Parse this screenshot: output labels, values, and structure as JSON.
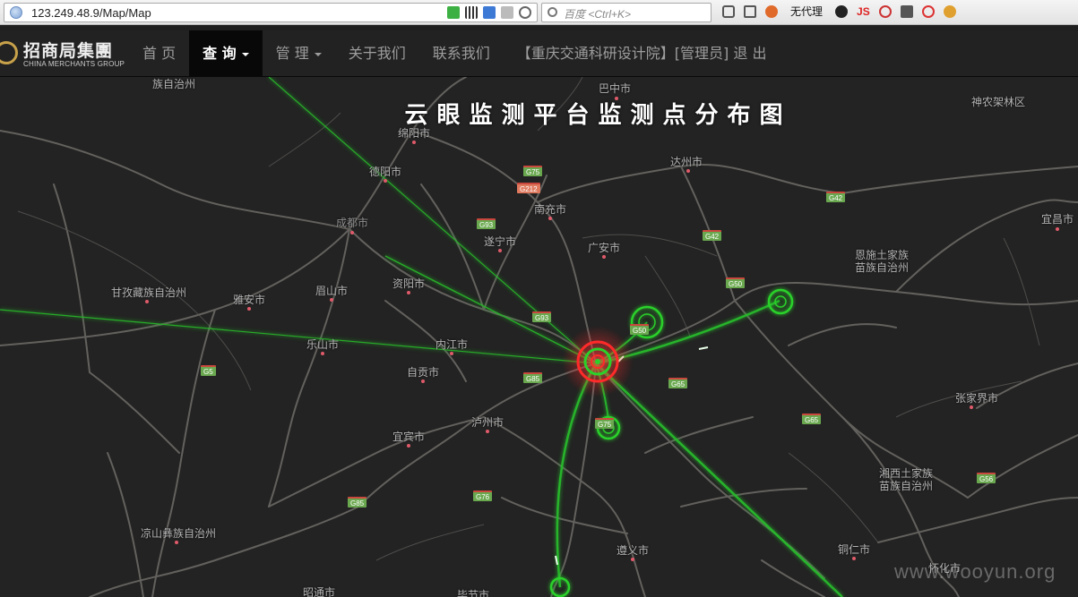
{
  "browser": {
    "url": "123.249.48.9/Map/Map",
    "search_placeholder": "百度 <Ctrl+K>",
    "proxy_label": "无代理",
    "js_label": "JS"
  },
  "nav": {
    "brand_cn": "招商局集團",
    "brand_en": "CHINA MERCHANTS GROUP",
    "items": [
      {
        "label": "首 页"
      },
      {
        "label": "查 询"
      },
      {
        "label": "管 理"
      },
      {
        "label": "关于我们"
      },
      {
        "label": "联系我们"
      },
      {
        "label": "【重庆交通科研设计院】[管理员] 退 出"
      }
    ]
  },
  "map": {
    "title": "云眼监测平台监测点分布图",
    "watermark": "www.wooyun.org",
    "colors": {
      "route": "#2ecc2e",
      "hub": "#ff2a2a",
      "city_dot": "#e05a6a"
    },
    "cities": [
      {
        "name": "阿坝藏族羌族自治州",
        "display": "族自治州"
      },
      {
        "name": "巴中市"
      },
      {
        "name": "神农架林区"
      },
      {
        "name": "绵阳市"
      },
      {
        "name": "德阳市"
      },
      {
        "name": "达州市"
      },
      {
        "name": "南充市"
      },
      {
        "name": "成都市"
      },
      {
        "name": "遂宁市"
      },
      {
        "name": "广安市"
      },
      {
        "name": "宜昌市"
      },
      {
        "name": "恩施土家族苗族自治州"
      },
      {
        "name": "甘孜藏族自治州"
      },
      {
        "name": "雅安市"
      },
      {
        "name": "眉山市"
      },
      {
        "name": "资阳市"
      },
      {
        "name": "乐山市"
      },
      {
        "name": "内江市"
      },
      {
        "name": "自贡市"
      },
      {
        "name": "泸州市"
      },
      {
        "name": "宜宾市"
      },
      {
        "name": "张家界市"
      },
      {
        "name": "湘西土家族苗族自治州"
      },
      {
        "name": "凉山彝族自治州"
      },
      {
        "name": "遵义市"
      },
      {
        "name": "铜仁市"
      },
      {
        "name": "昭通市"
      },
      {
        "name": "毕节市"
      },
      {
        "name": "怀化市"
      }
    ],
    "highways": [
      "G75",
      "G212",
      "G93",
      "G42",
      "G42",
      "G50",
      "G93",
      "G50",
      "G5",
      "G85",
      "G65",
      "G75",
      "G65",
      "G76",
      "G85",
      "G56"
    ]
  }
}
